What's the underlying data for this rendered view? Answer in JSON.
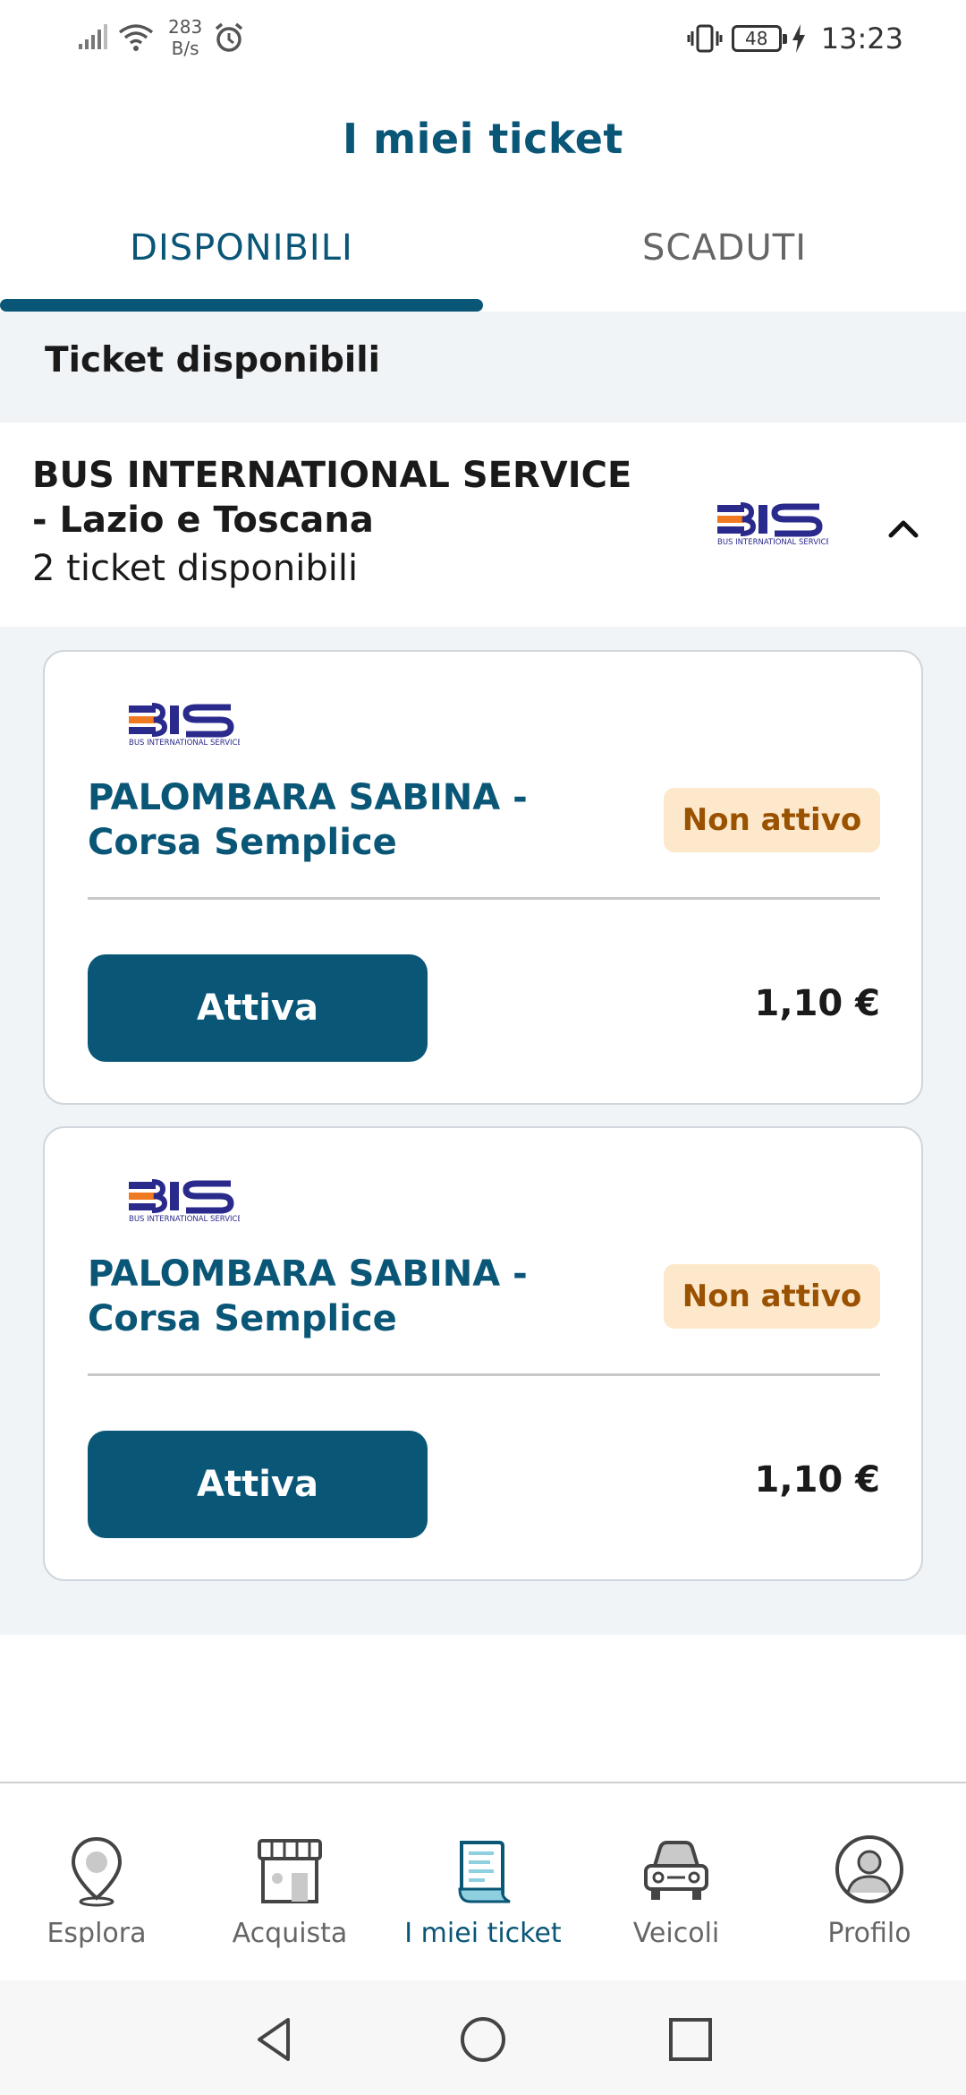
{
  "status_bar": {
    "net_speed_value": "283",
    "net_speed_unit": "B/s",
    "battery": "48",
    "time": "13:23"
  },
  "header": {
    "title": "I miei ticket"
  },
  "tabs": [
    {
      "label": "DISPONIBILI",
      "active": true
    },
    {
      "label": "SCADUTI",
      "active": false
    }
  ],
  "section": {
    "title": "Ticket disponibili"
  },
  "company": {
    "name": "BUS INTERNATIONAL SERVICE - Lazio e Toscana",
    "count": "2 ticket disponibili",
    "logo_text": "BIS",
    "logo_subtext": "BUS INTERNATIONAL SERVICE"
  },
  "tickets": [
    {
      "logo_text": "BIS",
      "logo_subtext": "BUS INTERNATIONAL SERVICE",
      "title": "PALOMBARA SABINA - Corsa Semplice",
      "status": "Non attivo",
      "button": "Attiva",
      "price": "1,10 €"
    },
    {
      "logo_text": "BIS",
      "logo_subtext": "BUS INTERNATIONAL SERVICE",
      "title": "PALOMBARA SABINA - Corsa Semplice",
      "status": "Non attivo",
      "button": "Attiva",
      "price": "1,10 €"
    }
  ],
  "bottom_nav": [
    {
      "label": "Esplora",
      "icon": "map-pin-icon",
      "active": false
    },
    {
      "label": "Acquista",
      "icon": "store-icon",
      "active": false
    },
    {
      "label": "I miei ticket",
      "icon": "ticket-icon",
      "active": true
    },
    {
      "label": "Veicoli",
      "icon": "car-icon",
      "active": false
    },
    {
      "label": "Profilo",
      "icon": "profile-icon",
      "active": false
    }
  ],
  "colors": {
    "primary": "#0a5677",
    "badge_bg": "#fde8cc",
    "badge_text": "#9a5200",
    "logo_blue": "#2a2a8c",
    "logo_orange": "#f07a22"
  }
}
